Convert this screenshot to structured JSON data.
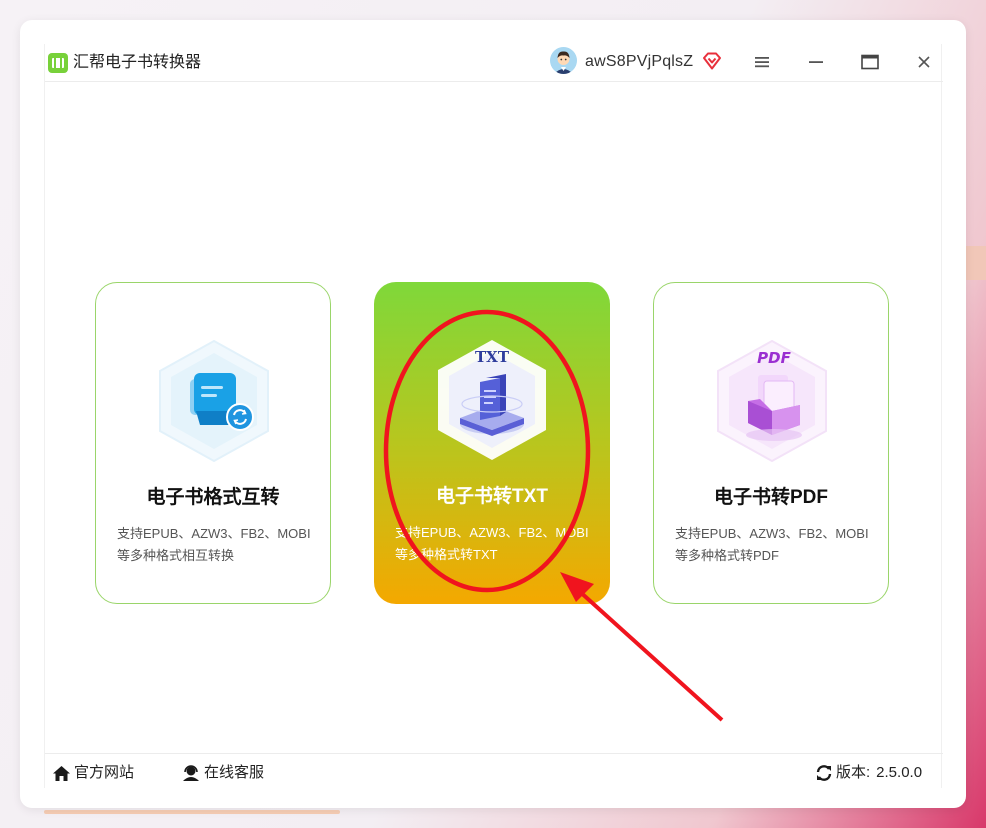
{
  "app": {
    "title": "汇帮电子书转换器",
    "username": "awS8PVjPqlsZ"
  },
  "icons": {
    "logo": "book-logo-icon",
    "vip": "vip-diamond-icon",
    "menu": "menu-icon",
    "minimize": "minimize-icon",
    "maximize": "maximize-icon",
    "close": "close-icon",
    "home": "home-icon",
    "support": "headset-icon",
    "refresh": "refresh-icon"
  },
  "cards": [
    {
      "title": "电子书格式互转",
      "desc_line1": "支持EPUB、AZW3、FB2、MOBI",
      "desc_line2": "等多种格式相互转换",
      "icon": "document-convert-icon"
    },
    {
      "title": "电子书转TXT",
      "desc_line1": "支持EPUB、AZW3、FB2、MOBI",
      "desc_line2": "等多种格式转TXT",
      "icon_label": "TXT",
      "icon": "txt-document-icon"
    },
    {
      "title": "电子书转PDF",
      "desc_line1": "支持EPUB、AZW3、FB2、MOBI",
      "desc_line2": "等多种格式转PDF",
      "icon_label": "PDF",
      "icon": "pdf-document-icon"
    }
  ],
  "footer": {
    "website": "官方网站",
    "support": "在线客服",
    "version_label": "版本:",
    "version_value": "2.5.0.0"
  },
  "colors": {
    "accent_green": "#7fd83a",
    "accent_orange": "#f4a800",
    "card_border": "#9ad56a",
    "annotation_red": "#f0141e"
  }
}
